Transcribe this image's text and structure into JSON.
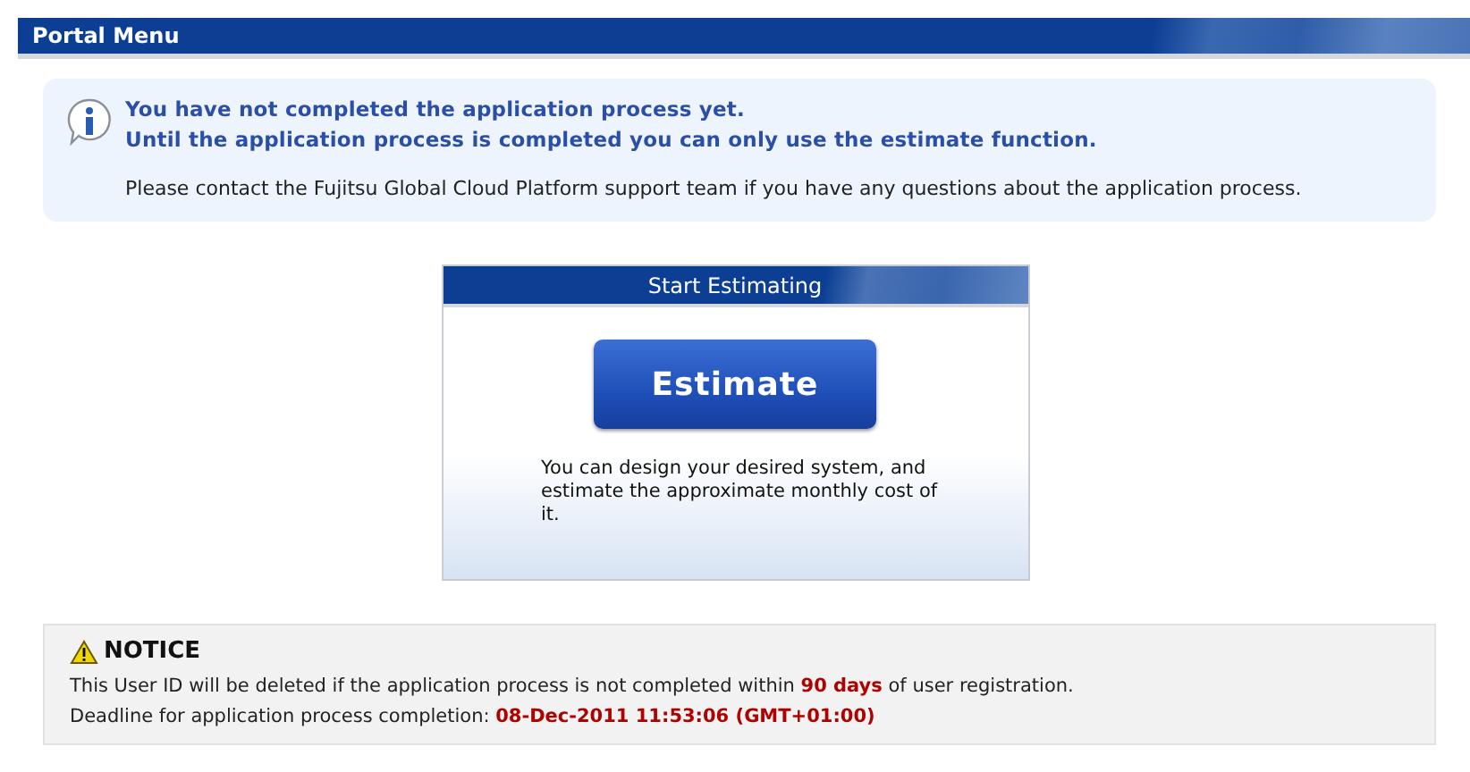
{
  "header": {
    "title": "Portal Menu"
  },
  "info": {
    "lines": [
      "You have not completed the application process yet.",
      "Until the application process is completed you can only use the estimate function."
    ],
    "note": "Please contact the Fujitsu Global Cloud Platform support team if you have any questions about the application process."
  },
  "card": {
    "title": "Start Estimating",
    "button": "Estimate",
    "description": "You can design your desired system, and estimate the approximate monthly cost of it."
  },
  "notice": {
    "title": "NOTICE",
    "lines": [
      "This User ID will be deleted if the application process is not completed within **90 days** of user registration.",
      "Deadline for application process completion: **08-Dec-2011 11:53:06 (GMT+01:00)**"
    ]
  }
}
